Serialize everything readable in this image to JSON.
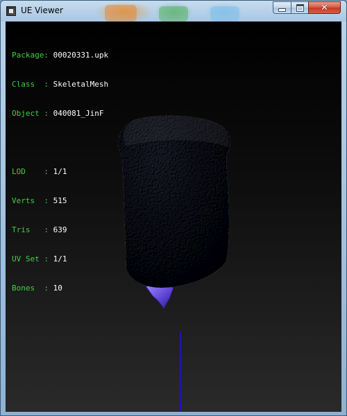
{
  "window": {
    "title": "UE Viewer",
    "controls": {
      "minimize": "_",
      "maximize": "□",
      "close": "✕"
    }
  },
  "info": {
    "package_label": "Package:",
    "package_value": "00020331.upk",
    "class_label": "Class  :",
    "class_value": "SkeletalMesh",
    "object_label": "Object :",
    "object_value": "040081_JinF",
    "lod_label": "LOD    :",
    "lod_value": "1/1",
    "verts_label": "Verts  :",
    "verts_value": "515",
    "tris_label": "Tris   :",
    "tris_value": "639",
    "uvset_label": "UV Set :",
    "uvset_value": "1/1",
    "bones_label": "Bones  :",
    "bones_value": "10"
  },
  "colors": {
    "label": "#3fd23f",
    "value": "#ffffff",
    "mesh": "#1b1d24",
    "tip": "#6a4fd6",
    "axis": "#1a1aa8"
  },
  "icons": {
    "app": "ue-viewer-icon",
    "minimize": "minimize-icon",
    "maximize": "maximize-icon",
    "close": "close-icon"
  }
}
